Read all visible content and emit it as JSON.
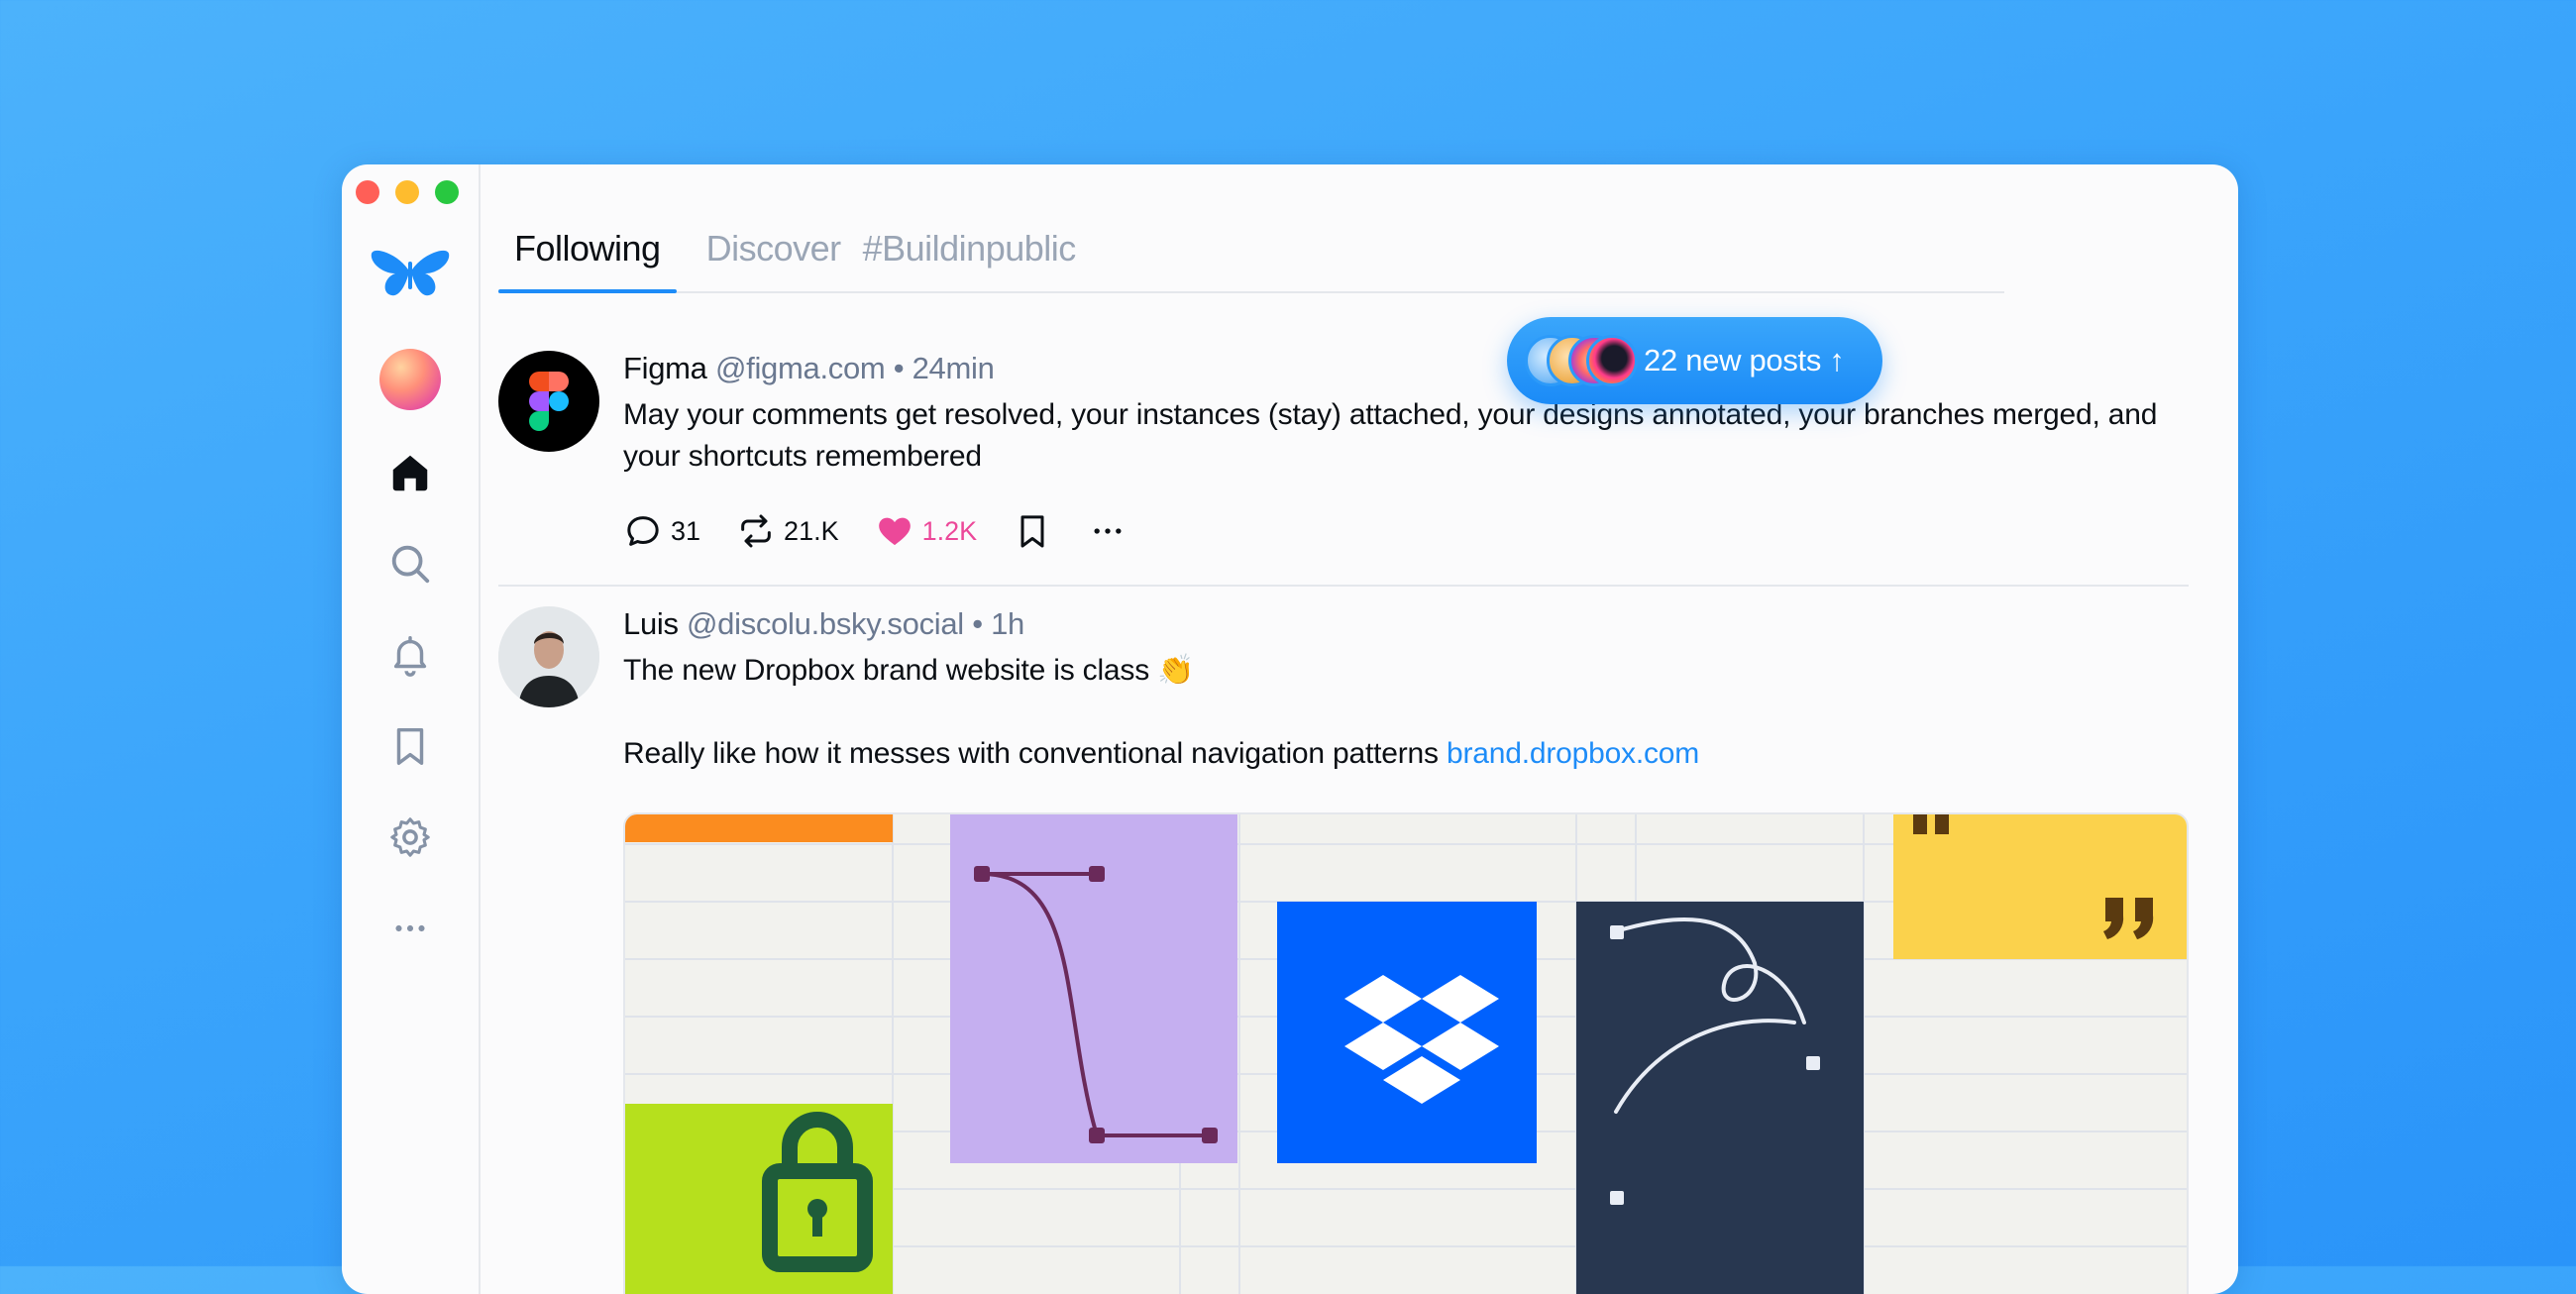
{
  "tabs": [
    {
      "label": "Following",
      "active": true
    },
    {
      "label": "Discover",
      "active": false
    },
    {
      "label": "#Buildinpublic",
      "active": false
    }
  ],
  "new_posts": {
    "label": "22 new posts ↑"
  },
  "sidebar": {
    "items": [
      {
        "icon": "butterfly-logo-icon"
      },
      {
        "icon": "avatar"
      },
      {
        "icon": "home-icon"
      },
      {
        "icon": "search-icon"
      },
      {
        "icon": "bell-icon"
      },
      {
        "icon": "bookmark-icon"
      },
      {
        "icon": "gear-icon"
      },
      {
        "icon": "more-icon"
      }
    ]
  },
  "posts": [
    {
      "author": "Figma",
      "handle": "@figma.com",
      "time": "• 24min",
      "text": "May your comments get resolved, your instances (stay) attached, your designs annotated, your branches merged, and your shortcuts remembered",
      "replies": "31",
      "reposts": "21.K",
      "likes": "1.2K"
    },
    {
      "author": "Luis",
      "handle": "@discolu.bsky.social",
      "time": "• 1h",
      "line1": "The new Dropbox brand website is class 👏",
      "line2": "Really like how it messes with conventional navigation patterns",
      "link": "brand.dropbox.com"
    }
  ],
  "colors": {
    "accent": "#1d8cf8",
    "like": "#ec4899",
    "background_gradient_start": "#4cb2fb",
    "background_gradient_end": "#2a94f9"
  }
}
